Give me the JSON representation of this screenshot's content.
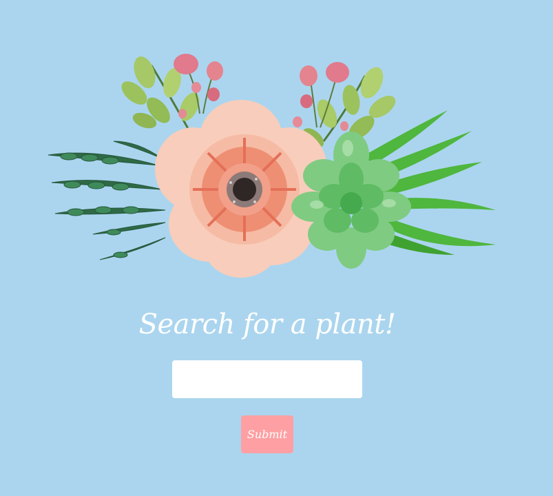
{
  "page": {
    "background_color": "#abd5ee"
  },
  "hero": {
    "image_icon": "flower-bouquet-illustration"
  },
  "search": {
    "heading": "Search for a plant!",
    "input_value": "",
    "input_placeholder": "",
    "submit_label": "Submit",
    "submit_color": "#fea0a3"
  }
}
